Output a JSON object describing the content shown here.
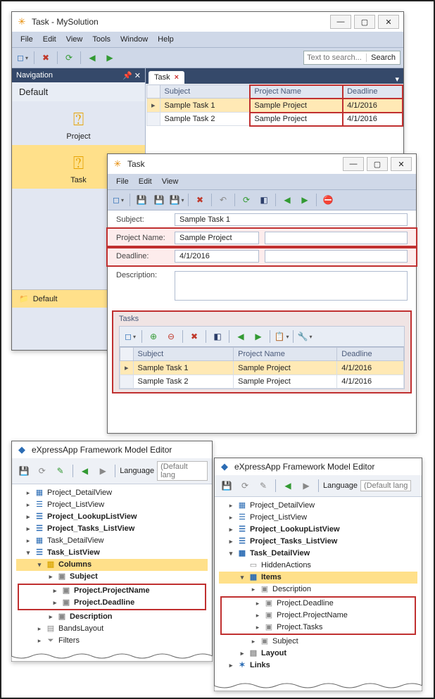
{
  "win1": {
    "title": "Task - MySolution",
    "menu": [
      "File",
      "Edit",
      "View",
      "Tools",
      "Window",
      "Help"
    ],
    "search_placeholder": "Text to search...",
    "search_btn": "Search",
    "nav": {
      "title": "Navigation",
      "header": "Default",
      "items": [
        {
          "label": "Project"
        },
        {
          "label": "Task"
        }
      ],
      "bottom": "Default"
    },
    "tab": "Task",
    "grid": {
      "cols": [
        "Subject",
        "Project Name",
        "Deadline"
      ],
      "rows": [
        {
          "subj": "Sample Task 1",
          "proj": "Sample Project",
          "dl": "4/1/2016",
          "sel": true
        },
        {
          "subj": "Sample Task 2",
          "proj": "Sample Project",
          "dl": "4/1/2016",
          "sel": false
        }
      ]
    }
  },
  "win2": {
    "title": "Task",
    "menu": [
      "File",
      "Edit",
      "View"
    ],
    "fields": {
      "subject_lbl": "Subject:",
      "subject_val": "Sample Task 1",
      "project_lbl": "Project Name:",
      "project_val": "Sample Project",
      "deadline_lbl": "Deadline:",
      "deadline_val": "4/1/2016",
      "desc_lbl": "Description:"
    },
    "tasks_lbl": "Tasks",
    "grid": {
      "cols": [
        "Subject",
        "Project Name",
        "Deadline"
      ],
      "rows": [
        {
          "subj": "Sample Task 1",
          "proj": "Sample Project",
          "dl": "4/1/2016",
          "sel": true
        },
        {
          "subj": "Sample Task 2",
          "proj": "Sample Project",
          "dl": "4/1/2016",
          "sel": false
        }
      ]
    }
  },
  "me1": {
    "title": "eXpressApp Framework Model Editor",
    "lang_lbl": "Language",
    "lang_val": "(Default lang"
  },
  "me2": {
    "title": "eXpressApp Framework Model Editor",
    "lang_lbl": "Language",
    "lang_val": "(Default lang"
  },
  "tree1": {
    "n0": "Project_DetailView",
    "n1": "Project_ListView",
    "n2": "Project_LookupListView",
    "n3": "Project_Tasks_ListView",
    "n4": "Task_DetailView",
    "n5": "Task_ListView",
    "n6": "Columns",
    "n7": "Subject",
    "n8": "Project.ProjectName",
    "n9": "Project.Deadline",
    "n10": "Description",
    "n11": "BandsLayout",
    "n12": "Filters"
  },
  "tree2": {
    "n0": "Project_DetailView",
    "n1": "Project_ListView",
    "n2": "Project_LookupListView",
    "n3": "Project_Tasks_ListView",
    "n4": "Task_DetailView",
    "n5": "HiddenActions",
    "n6": "Items",
    "n7": "Description",
    "n8": "Project.Deadline",
    "n9": "Project.ProjectName",
    "n10": "Project.Tasks",
    "n11": "Subject",
    "n12": "Layout",
    "n13": "Links"
  }
}
